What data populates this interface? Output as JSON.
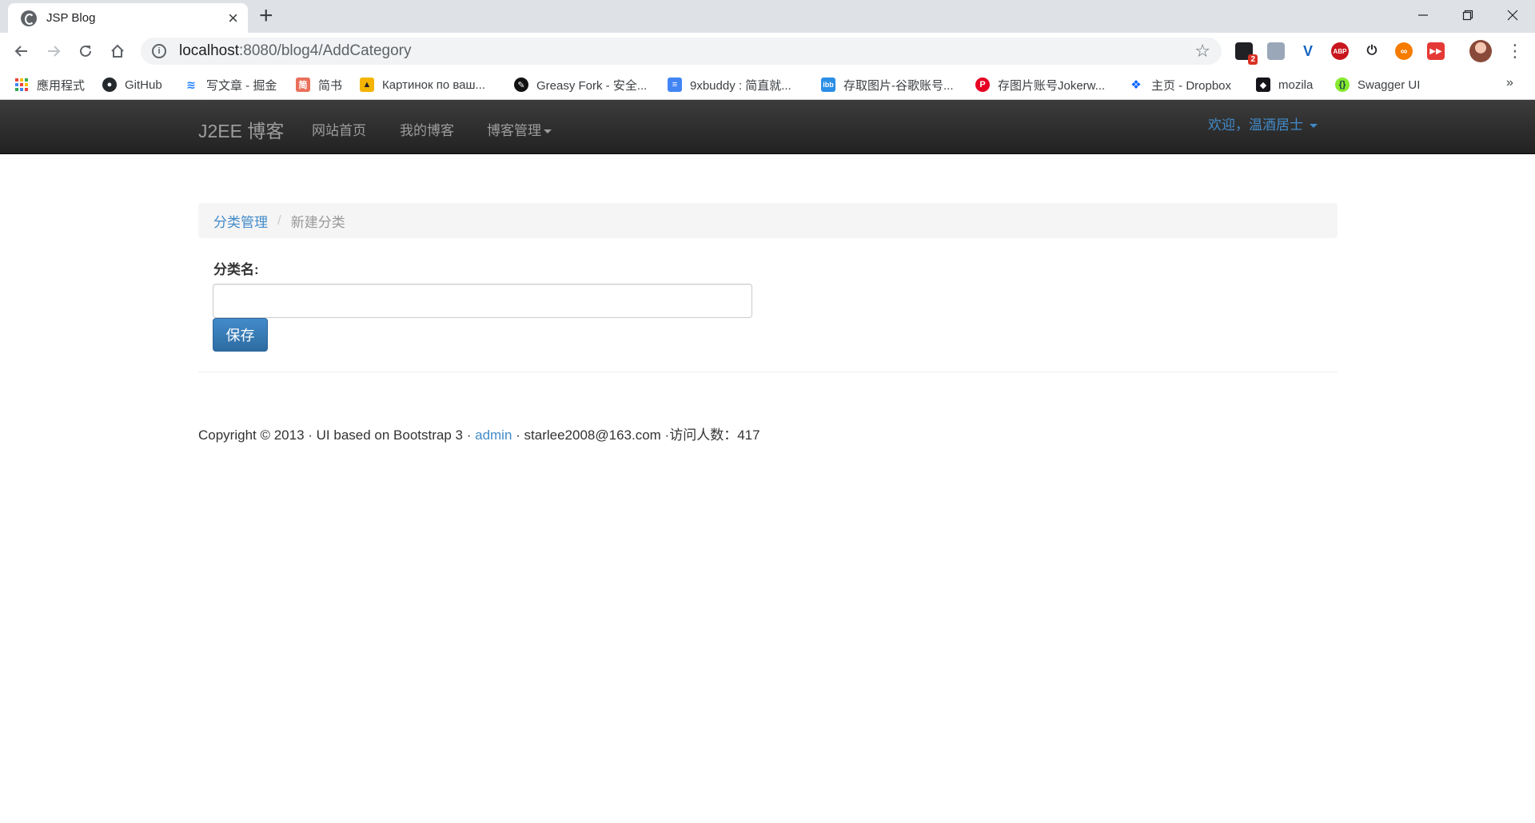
{
  "browser": {
    "tab_title": "JSP Blog",
    "tab_close": "×",
    "new_tab": "+",
    "url_host": "localhost",
    "url_path": ":8080/blog4/AddCategory",
    "ext_badge": "2",
    "ext_abp": "ABP",
    "more_bookmarks": "»"
  },
  "bookmarks": [
    {
      "label": "應用程式",
      "icon": "apps-grid-icon",
      "color": "#ea4335"
    },
    {
      "label": "GitHub",
      "icon": "github-icon",
      "color": "#24292e"
    },
    {
      "label": "写文章 - 掘金",
      "icon": "juejin-icon",
      "color": "#1e80ff"
    },
    {
      "label": "简书",
      "icon": "jianshu-icon",
      "color": "#ea6f5a"
    },
    {
      "label": "Картинок по ваш...",
      "icon": "image-icon",
      "color": "#f4b400"
    },
    {
      "label": "Greasy Fork - 安全...",
      "icon": "greasyfork-icon",
      "color": "#111"
    },
    {
      "label": "9xbuddy : 简直就...",
      "icon": "document-icon",
      "color": "#4285f4"
    },
    {
      "label": "存取图片-谷歌账号...",
      "icon": "ibb-icon",
      "color": "#2a8ee6"
    },
    {
      "label": "存图片账号Jokerw...",
      "icon": "pinterest-icon",
      "color": "#e60023"
    },
    {
      "label": "主页 - Dropbox",
      "icon": "dropbox-icon",
      "color": "#0061ff"
    },
    {
      "label": "mozila",
      "icon": "mdn-icon",
      "color": "#15141a"
    },
    {
      "label": "Swagger UI",
      "icon": "swagger-icon",
      "color": "#85ea2d"
    }
  ],
  "navbar": {
    "brand": "J2EE 博客",
    "home": "网站首页",
    "my_blog": "我的博客",
    "manage": "博客管理",
    "user": "欢迎，温酒居士"
  },
  "breadcrumb": {
    "parent": "分类管理",
    "separator": "/",
    "current": "新建分类"
  },
  "form": {
    "label": "分类名:",
    "value": "",
    "save": "保存"
  },
  "footer": {
    "prefix": "Copyright © 2013 · UI based on Bootstrap 3 · ",
    "link": "admin",
    "suffix": " · starlee2008@163.com ·访问人数：417"
  },
  "colors": {
    "link": "#428bca",
    "navbar": "#222222",
    "primary_button": "#428bca"
  }
}
